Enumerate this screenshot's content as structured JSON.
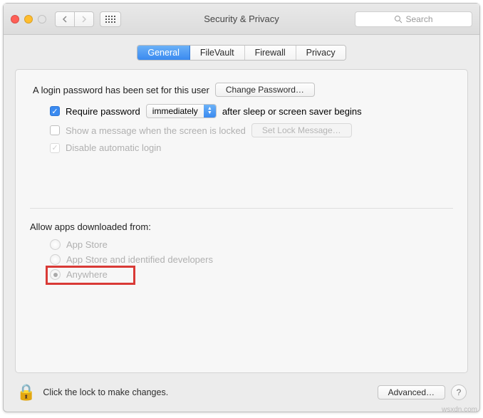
{
  "titlebar": {
    "title": "Security & Privacy",
    "search_placeholder": "Search"
  },
  "tabs": [
    "General",
    "FileVault",
    "Firewall",
    "Privacy"
  ],
  "active_tab": 0,
  "section_login": {
    "heading": "A login password has been set for this user",
    "change_password_btn": "Change Password…",
    "require_password_label": "Require password",
    "require_password_checked": true,
    "require_password_select": "immediately",
    "after_sleep_text": "after sleep or screen saver begins",
    "show_message_checked": false,
    "show_message_label": "Show a message when the screen is locked",
    "set_lock_message_btn": "Set Lock Message…",
    "disable_auto_login_checked": true,
    "disable_auto_login_label": "Disable automatic login"
  },
  "section_allow": {
    "heading": "Allow apps downloaded from:",
    "options": [
      "App Store",
      "App Store and identified developers",
      "Anywhere"
    ],
    "selected_index": 2
  },
  "footer": {
    "lock_text": "Click the lock to make changes.",
    "advanced_btn": "Advanced…",
    "help": "?"
  },
  "watermark": "wsxdn.com"
}
